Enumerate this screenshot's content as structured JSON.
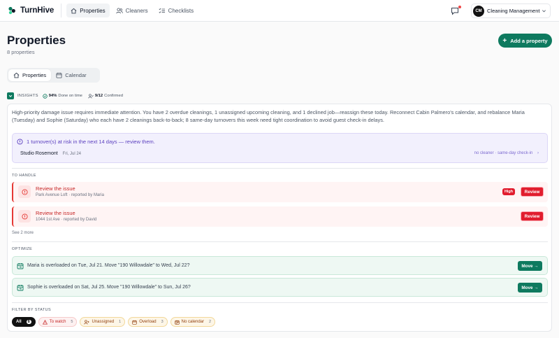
{
  "app": {
    "name": "TurnHive"
  },
  "nav": {
    "items": [
      {
        "label": "Properties",
        "icon": "home-icon",
        "active": true
      },
      {
        "label": "Cleaners",
        "icon": "users-icon",
        "active": false
      },
      {
        "label": "Checklists",
        "icon": "checklist-icon",
        "active": false
      }
    ]
  },
  "org": {
    "initials": "CM",
    "name": "Cleaning Management"
  },
  "page": {
    "title": "Properties",
    "subtitle": "8 properties",
    "add_label": "Add a property"
  },
  "view_tabs": [
    {
      "label": "Properties",
      "active": true
    },
    {
      "label": "Calendar",
      "active": false
    }
  ],
  "insights": {
    "label": "INSIGHTS",
    "done_on_time": "94%",
    "done_on_time_label": "Done on time",
    "confirmed": "9/12",
    "confirmed_label": "Confirmed",
    "summary": "High-priority damage issue requires immediate attention. You have 2 overdue cleanings, 1 unassigned upcoming cleaning, and 1 declined job—reassign these today. Reconnect Cabin Palmero's calendar, and rebalance Maria (Tuesday) and Sophie (Saturday) who each have 2 cleanings back-to-back; 8 same-day turnovers this week need tight coordination to avoid guest check-in delays.",
    "risk": {
      "title": "1 turnover(s) at risk in the next 14 days — review them.",
      "property": "Studio Rosemont",
      "date": "Fri, Jul 24",
      "meta": "no cleaner · same-day check-in"
    },
    "to_handle_label": "TO HANDLE",
    "issues": [
      {
        "title": "Review the issue",
        "subtitle": "Park Avenue Loft · reported by Maria",
        "badge": "High",
        "action": "Review"
      },
      {
        "title": "Review the issue",
        "subtitle": "1044 1st Ave · reported by David",
        "badge": "",
        "action": "Review"
      }
    ],
    "see_more": "See 2 more",
    "optimize_label": "OPTIMIZE",
    "optimize": [
      {
        "text": "Maria is overloaded on Tue, Jul 21. Move \"190 Willowdale\" to Wed, Jul 22?",
        "action": "Move →"
      },
      {
        "text": "Sophie is overloaded on Sat, Jul 25. Move \"190 Willowdale\" to Sun, Jul 26?",
        "action": "Move →"
      }
    ],
    "filter_label": "FILTER BY STATUS",
    "filters": [
      {
        "label": "All",
        "count": "8"
      },
      {
        "label": "To watch",
        "count": "5"
      },
      {
        "label": "Unassigned",
        "count": "1"
      },
      {
        "label": "Overload",
        "count": "3"
      },
      {
        "label": "No calendar",
        "count": "2"
      }
    ]
  },
  "colors": {
    "brand": "#0e7a5f",
    "danger": "#e11d2e",
    "risk": "#5b3fbf",
    "warning": "#92400e"
  }
}
